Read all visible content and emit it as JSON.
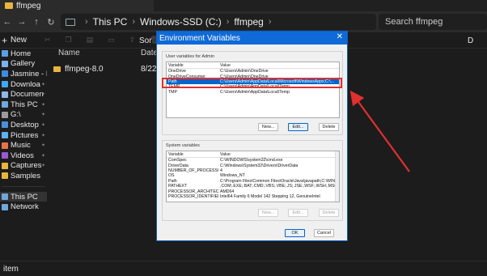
{
  "explorer": {
    "tab_title": "ffmpeg",
    "breadcrumb": [
      "This PC",
      "Windows-SSD (C:)",
      "ffmpeg"
    ],
    "search_placeholder": "Search ffmpeg",
    "new_label": "New",
    "sort_label": "Sor",
    "details_label": "D",
    "columns": {
      "name": "Name",
      "date": "Date"
    },
    "files": [
      {
        "name": "ffmpeg-8.0",
        "date": "8/22"
      }
    ],
    "status_text": "item",
    "sidebar": [
      {
        "label": "Home",
        "icon": "home-icon",
        "color": "#5aa0e6"
      },
      {
        "label": "Gallery",
        "icon": "gallery-icon",
        "color": "#7ab3f0"
      },
      {
        "label": "Jasmine - P",
        "icon": "cloud-icon",
        "color": "#3b8de0"
      },
      {
        "label": "Downloa",
        "icon": "download-icon",
        "color": "#3fa9f5",
        "pinned": true
      },
      {
        "label": "Documen",
        "icon": "document-icon",
        "color": "#8fb7e8",
        "pinned": true
      },
      {
        "label": "This PC",
        "icon": "pc-icon",
        "color": "#6fa8dc",
        "pinned": true
      },
      {
        "label": "G:\\",
        "icon": "drive-icon",
        "color": "#9a9a9a",
        "pinned": true
      },
      {
        "label": "Desktop",
        "icon": "desktop-icon",
        "color": "#4a90d9",
        "pinned": true
      },
      {
        "label": "Pictures",
        "icon": "pictures-icon",
        "color": "#5fb0f0",
        "pinned": true
      },
      {
        "label": "Music",
        "icon": "music-icon",
        "color": "#e8734a",
        "pinned": true
      },
      {
        "label": "Videos",
        "icon": "videos-icon",
        "color": "#9b59d0",
        "pinned": true
      },
      {
        "label": "Captures",
        "icon": "folder-icon",
        "color": "#e8b540",
        "pinned": true
      },
      {
        "label": "Samples",
        "icon": "folder-icon",
        "color": "#e8b540"
      }
    ],
    "sidebar_bottom": [
      {
        "label": "This PC",
        "icon": "pc-icon",
        "color": "#6fa8dc",
        "selected": true
      },
      {
        "label": "Network",
        "icon": "network-icon",
        "color": "#6fa8dc"
      }
    ]
  },
  "dialog": {
    "title": "Environment Variables",
    "user_group_label": "User variables for Admin",
    "system_group_label": "System variables",
    "col_variable": "Variable",
    "col_value": "Value",
    "user_vars": [
      {
        "name": "OneDrive",
        "value": "C:\\Users\\Admin\\OneDrive"
      },
      {
        "name": "OneDriveConsumer",
        "value": "C:\\Users\\Admin\\OneDrive"
      },
      {
        "name": "Path",
        "value": "C:\\Users\\Admin\\AppData\\Local\\Microsoft\\WindowsApps;C:\\...",
        "selected": true
      },
      {
        "name": "TEMP",
        "value": "C:\\Users\\Admin\\AppData\\Local\\Temp"
      },
      {
        "name": "TMP",
        "value": "C:\\Users\\Admin\\AppData\\Local\\Temp"
      }
    ],
    "system_vars": [
      {
        "name": "ComSpec",
        "value": "C:\\WINDOWS\\system32\\cmd.exe"
      },
      {
        "name": "DriverData",
        "value": "C:\\Windows\\System32\\Drivers\\DriverData"
      },
      {
        "name": "NUMBER_OF_PROCESSORS",
        "value": "4"
      },
      {
        "name": "OS",
        "value": "Windows_NT"
      },
      {
        "name": "Path",
        "value": "C:\\Program Files\\Common Files\\Oracle\\Java\\javapath;C:\\WIN..."
      },
      {
        "name": "PATHEXT",
        "value": ".COM;.EXE;.BAT;.CMD;.VBS;.VBE;.JS;.JSE;.WSF;.WSH;.MSC;.PY;.PYW"
      },
      {
        "name": "PROCESSOR_ARCHITECTU...",
        "value": "AMD64"
      },
      {
        "name": "PROCESSOR_IDENTIFIER",
        "value": "Intel64 Family 6 Model 142 Stepping 12, GenuineIntel"
      }
    ],
    "user_buttons": {
      "new": "New...",
      "edit": "Edit...",
      "delete": "Delete"
    },
    "system_buttons": {
      "new": "New...",
      "edit": "Edit...",
      "delete": "Delete"
    },
    "ok": "OK",
    "cancel": "Cancel",
    "close_glyph": "✕"
  },
  "annotation": {
    "highlight_color": "#e03030"
  }
}
